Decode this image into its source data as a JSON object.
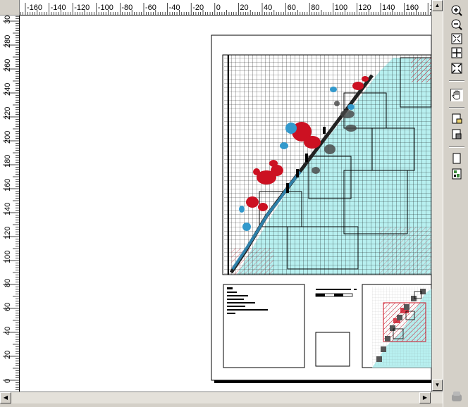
{
  "rulers": {
    "horizontal_labels": [
      "-160",
      "-140",
      "-120",
      "-100",
      "-80",
      "-60",
      "-40",
      "-20",
      "0",
      "20",
      "40",
      "60",
      "80",
      "100",
      "120",
      "140",
      "160",
      "18"
    ],
    "vertical_labels": [
      "300",
      "280",
      "260",
      "240",
      "220",
      "200",
      "180",
      "160",
      "140",
      "120",
      "100",
      "80",
      "60",
      "40",
      "20",
      "0"
    ]
  },
  "toolbar": {
    "tools": [
      {
        "name": "zoom-in-tool",
        "icon": "zoom-in-icon"
      },
      {
        "name": "zoom-out-tool",
        "icon": "zoom-out-icon"
      },
      {
        "name": "zoom-whole-page-tool",
        "icon": "zoom-page-icon"
      },
      {
        "name": "zoom-100-percent-tool",
        "icon": "zoom-actual-icon"
      },
      {
        "name": "fixed-zoom-out-tool",
        "icon": "zoom-fixed-out-icon"
      },
      {
        "name": "pan-tool",
        "icon": "hand-icon",
        "active": true
      },
      {
        "name": "go-back-extent-tool",
        "icon": "back-extent-icon"
      },
      {
        "name": "go-forward-extent-tool",
        "icon": "forward-extent-icon"
      },
      {
        "name": "page-setup-tool",
        "icon": "page-icon"
      },
      {
        "name": "toggle-draft-mode-tool",
        "icon": "draft-mode-icon"
      }
    ]
  },
  "colors": {
    "sea": "#b8f0f0",
    "land": "#ffffff",
    "red": "#cc1122",
    "blue": "#3399cc",
    "dark": "#333333"
  }
}
